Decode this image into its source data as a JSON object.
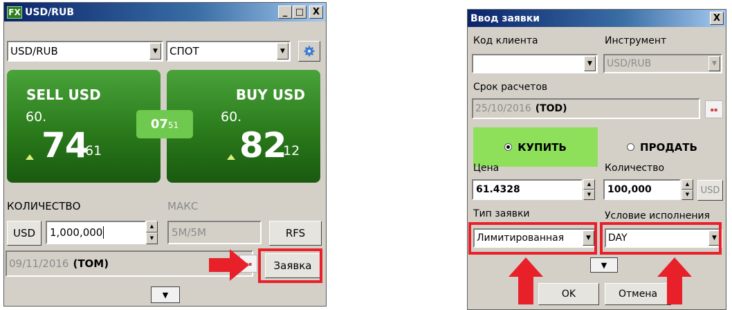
{
  "left_window": {
    "badge": "FX",
    "title": "USD/RUB",
    "controls": {
      "minimize": "_",
      "maximize": "□",
      "close": "X"
    },
    "instrument_select": "USD/RUB",
    "tenor_select": "СПОТ",
    "sell_tile": {
      "label": "SELL USD",
      "price_prefix": "60.",
      "price_big": "74",
      "price_frac": "61"
    },
    "buy_tile": {
      "label": "BUY USD",
      "price_prefix": "60.",
      "price_big": "82",
      "price_frac": "12"
    },
    "spread": {
      "big": "07",
      "small": "51"
    },
    "quantity_label": "КОЛИЧЕСТВО",
    "max_label": "МАКС",
    "currency_button": "USD",
    "quantity_value": "1,000,000",
    "max_value": "5M/5M",
    "rfs_button": "RFS",
    "settlement_date": "09/11/2016",
    "settlement_tag": "(TOM)",
    "order_button": "Заявка",
    "calendar_icon": "calendar-icon",
    "expand_icon": "chevron-down-icon"
  },
  "right_window": {
    "title": "Ввод заявки",
    "close": "X",
    "client_code_label": "Код клиента",
    "client_code_value": "",
    "instrument_label": "Инструмент",
    "instrument_value": "USD/RUB",
    "settlement_label": "Срок расчетов",
    "settlement_date": "25/10/2016",
    "settlement_tag": "(TOD)",
    "buy_label": "КУПИТЬ",
    "sell_label": "ПРОДАТЬ",
    "price_label": "Цена",
    "price_value": "61.4328",
    "quantity_label": "Количество",
    "quantity_value": "100,000",
    "quantity_currency": "USD",
    "order_type_label": "Тип заявки",
    "order_type_value": "Лимитированная",
    "condition_label": "Условие исполнения",
    "condition_value": "DAY",
    "ok_button": "OK",
    "cancel_button": "Отмена"
  },
  "colors": {
    "tile_green": "#2a7a1b",
    "buy_highlight": "#8ee05b",
    "annotation_red": "#e8202a",
    "title_blue": "#0a246a"
  }
}
